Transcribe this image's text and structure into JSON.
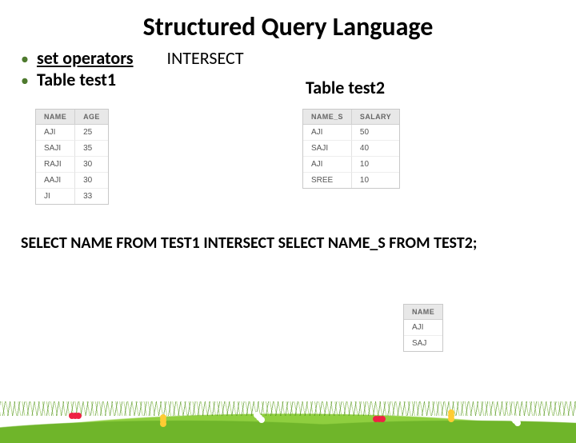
{
  "title": "Structured Query Language",
  "bullets": {
    "set_operators": "set operators",
    "intersect": "INTERSECT",
    "table1_label": "Table test1",
    "table2_label": "Table test2"
  },
  "table1": {
    "headers": {
      "c0": "NAME",
      "c1": "AGE"
    },
    "rows": [
      {
        "c0": "AJI",
        "c1": "25"
      },
      {
        "c0": "SAJI",
        "c1": "35"
      },
      {
        "c0": "RAJI",
        "c1": "30"
      },
      {
        "c0": "AAJI",
        "c1": "30"
      },
      {
        "c0": "JI",
        "c1": "33"
      }
    ]
  },
  "table2": {
    "headers": {
      "c0": "NAME_S",
      "c1": "SALARY"
    },
    "rows": [
      {
        "c0": "AJI",
        "c1": "50"
      },
      {
        "c0": "SAJI",
        "c1": "40"
      },
      {
        "c0": "AJI",
        "c1": "10"
      },
      {
        "c0": "SREE",
        "c1": "10"
      }
    ]
  },
  "sql": "SELECT NAME FROM TEST1 INTERSECT SELECT NAME_S FROM TEST2;",
  "result": {
    "headers": {
      "c0": "NAME"
    },
    "rows": [
      {
        "c0": "AJI"
      },
      {
        "c0": "SAJ"
      }
    ]
  }
}
